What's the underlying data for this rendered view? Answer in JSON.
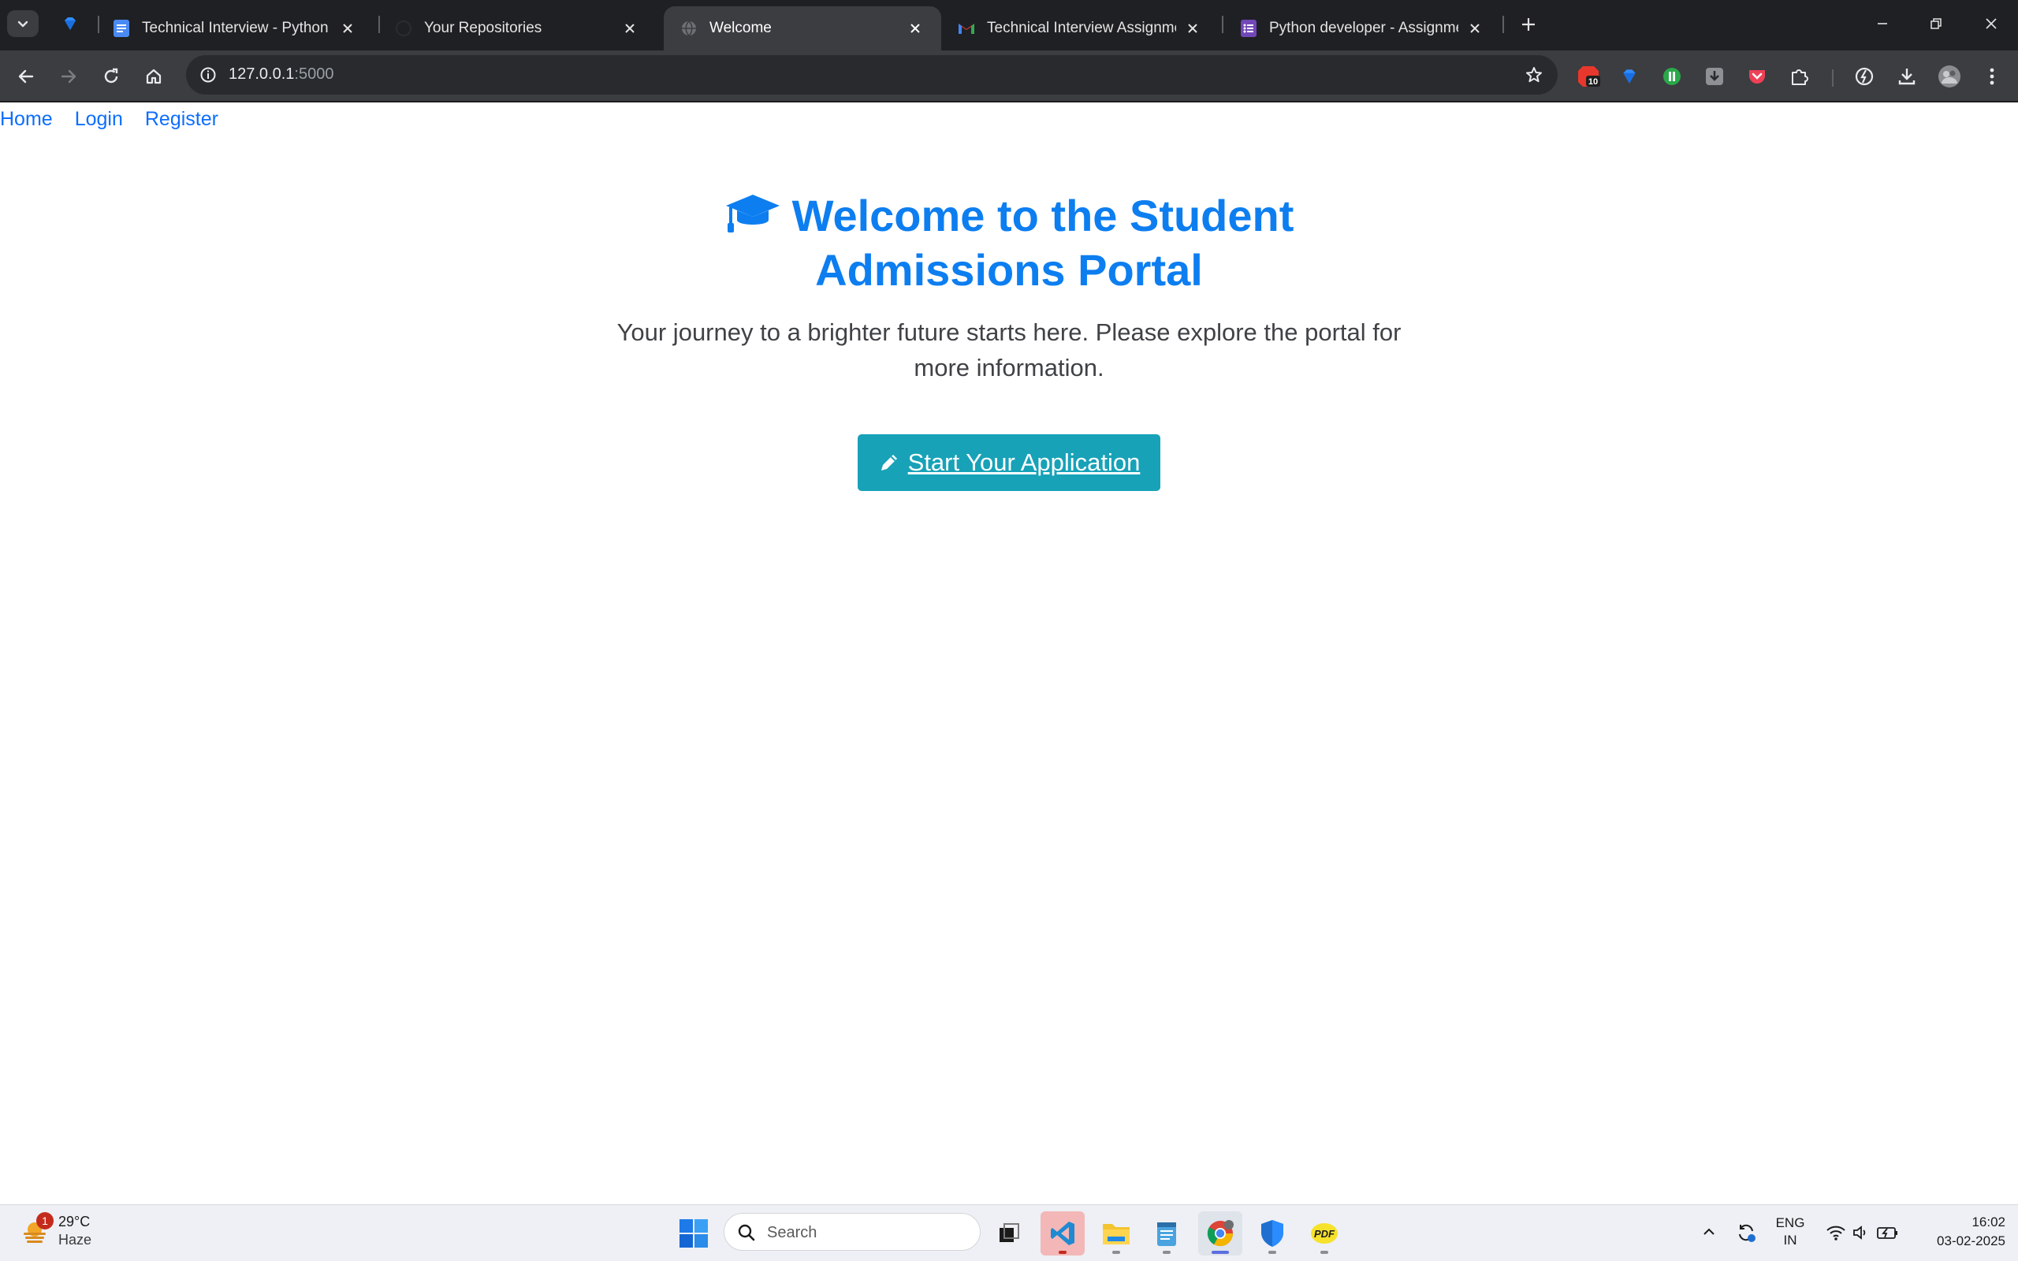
{
  "browser": {
    "tabs": [
      {
        "title": "Technical Interview - Python",
        "favicon": "google-docs-icon",
        "active": false
      },
      {
        "title": "Your Repositories",
        "favicon": "github-icon",
        "active": false
      },
      {
        "title": "Welcome",
        "favicon": "globe-icon",
        "active": true
      },
      {
        "title": "Technical Interview Assignment",
        "favicon": "gmail-icon",
        "active": false
      },
      {
        "title": "Python developer - Assignment",
        "favicon": "google-forms-icon",
        "active": false
      }
    ],
    "address": {
      "host": "127.0.0.1",
      "port": ":5000"
    },
    "extension_badge": "10"
  },
  "page": {
    "nav": [
      "Home",
      "Login",
      "Register"
    ],
    "hero": {
      "title": "Welcome to the Student Admissions Portal",
      "lead": "Your journey to a brighter future starts here. Please explore the portal for more information.",
      "cta": "Start Your Application"
    },
    "colors": {
      "primary": "#0d6efd",
      "cta": "#17a2b8"
    }
  },
  "taskbar": {
    "weather": {
      "temp": "29°C",
      "condition": "Haze",
      "badge": "1"
    },
    "search_placeholder": "Search",
    "language": {
      "line1": "ENG",
      "line2": "IN"
    },
    "time": "16:02",
    "date": "03-02-2025"
  }
}
